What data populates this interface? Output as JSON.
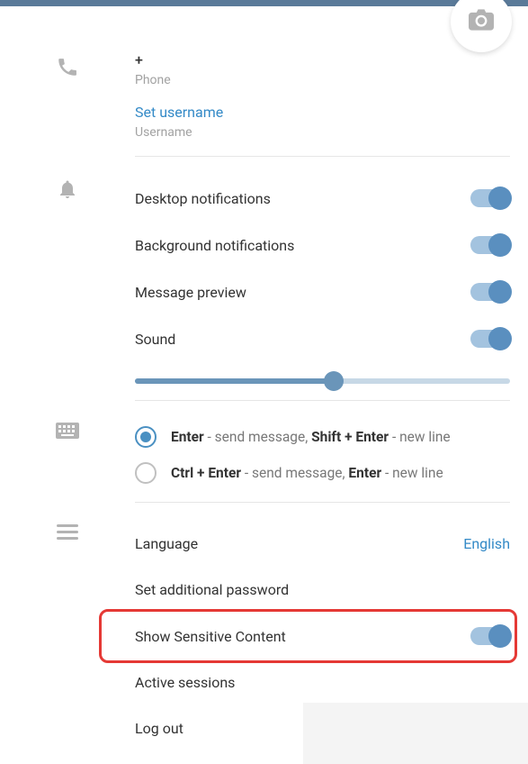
{
  "profile": {
    "phone_value": "+",
    "phone_label": "Phone",
    "set_username_link": "Set username",
    "username_label": "Username"
  },
  "notifications": {
    "desktop": "Desktop notifications",
    "background": "Background notifications",
    "preview": "Message preview",
    "sound": "Sound",
    "volume_percent": 53
  },
  "input_mode": {
    "opt1_key1": "Enter",
    "opt1_mid": " - send message, ",
    "opt1_key2": "Shift + Enter",
    "opt1_end": " - new line",
    "opt2_key1": "Ctrl + Enter",
    "opt2_mid": " - send message, ",
    "opt2_key2": "Enter",
    "opt2_end": " - new line"
  },
  "general": {
    "language_label": "Language",
    "language_value": "English",
    "additional_password": "Set additional password",
    "sensitive_content": "Show Sensitive Content",
    "active_sessions": "Active sessions",
    "logout": "Log out"
  }
}
